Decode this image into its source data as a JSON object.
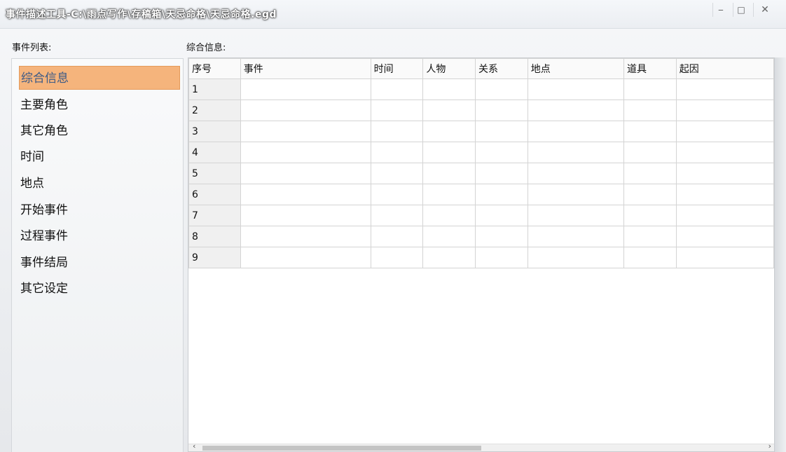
{
  "window": {
    "title": "事件描述工具-C:\\雨点写作\\存稿箱\\天忌命格\\天忌命格.egd",
    "minimize_glyph": "‒",
    "maximize_glyph": "□",
    "close_glyph": "✕"
  },
  "left": {
    "label": "事件列表:",
    "items": [
      "综合信息",
      "主要角色",
      "其它角色",
      "时间",
      "地点",
      "开始事件",
      "过程事件",
      "事件结局",
      "其它设定"
    ],
    "selected_index": 0,
    "selected_bg": "#f5b47c",
    "selected_fg": "#3b5a87"
  },
  "right": {
    "label": "综合信息:",
    "columns": [
      "序号",
      "事件",
      "时间",
      "人物",
      "关系",
      "地点",
      "道具",
      "起因"
    ],
    "rows": [
      "1",
      "2",
      "3",
      "4",
      "5",
      "6",
      "7",
      "8",
      "9"
    ]
  },
  "scrollbar": {
    "left_arrow": "‹",
    "right_arrow": "›"
  }
}
